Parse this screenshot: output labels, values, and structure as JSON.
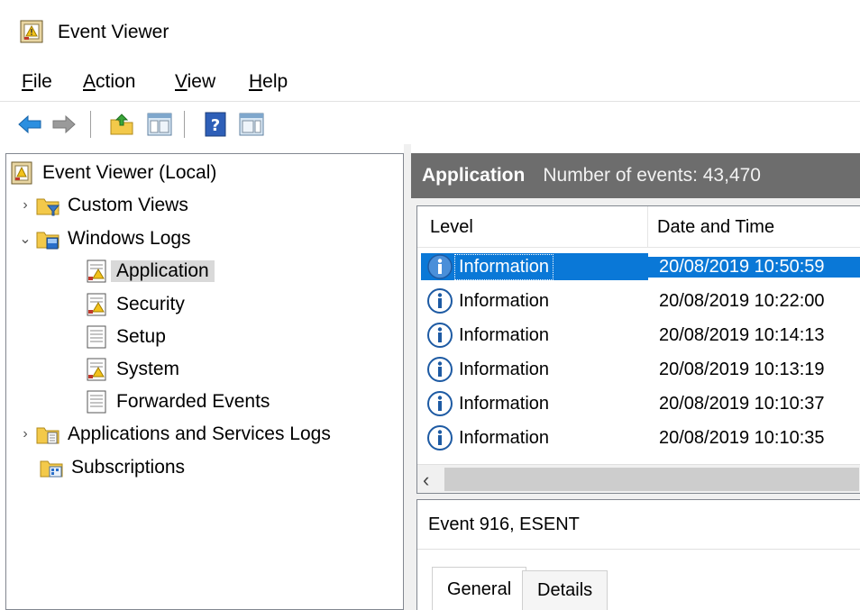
{
  "window": {
    "title": "Event Viewer"
  },
  "menu": [
    {
      "label": "File",
      "mnemonic": "F",
      "rest": "ile"
    },
    {
      "label": "Action",
      "mnemonic": "A",
      "rest": "ction"
    },
    {
      "label": "View",
      "mnemonic": "V",
      "rest": "iew"
    },
    {
      "label": "Help",
      "mnemonic": "H",
      "rest": "elp"
    }
  ],
  "toolbar": {
    "buttons": [
      "back-arrow-icon",
      "forward-arrow-icon",
      "up-folder-icon",
      "show-hide-console-tree-icon",
      "help-icon",
      "show-hide-action-pane-icon"
    ]
  },
  "tree": {
    "root": "Event Viewer (Local)",
    "custom_views": "Custom Views",
    "windows_logs": "Windows Logs",
    "application": "Application",
    "security": "Security",
    "setup": "Setup",
    "system": "System",
    "forwarded_events": "Forwarded Events",
    "app_services_logs": "Applications and Services Logs",
    "subscriptions": "Subscriptions"
  },
  "log_header": {
    "log_name": "Application",
    "count_text": "Number of events: 43,470"
  },
  "columns": {
    "level": "Level",
    "date": "Date and Time"
  },
  "events": [
    {
      "level": "Information",
      "date": "20/08/2019 10:50:59",
      "selected": true
    },
    {
      "level": "Information",
      "date": "20/08/2019 10:22:00"
    },
    {
      "level": "Information",
      "date": "20/08/2019 10:14:13"
    },
    {
      "level": "Information",
      "date": "20/08/2019 10:13:19"
    },
    {
      "level": "Information",
      "date": "20/08/2019 10:10:37"
    },
    {
      "level": "Information",
      "date": "20/08/2019 10:10:35"
    }
  ],
  "detail": {
    "title": "Event 916, ESENT",
    "tabs": [
      "General",
      "Details"
    ]
  },
  "colors": {
    "selection": "#0a78d7",
    "header_bar": "#6d6d6d"
  }
}
